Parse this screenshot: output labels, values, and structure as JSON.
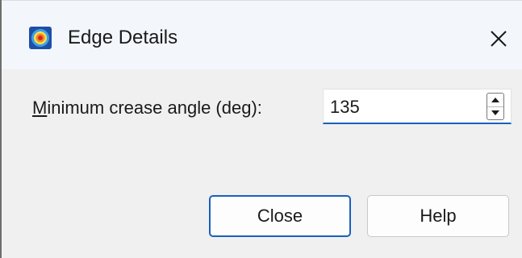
{
  "window": {
    "title": "Edge Details",
    "app_icon": "app-logo-icon",
    "close_icon": "close-icon"
  },
  "form": {
    "label_mnemonic": "M",
    "label_rest": "inimum crease angle (deg):",
    "value": "135",
    "spin_up_icon": "arrow-up-icon",
    "spin_down_icon": "arrow-down-icon"
  },
  "buttons": {
    "close_label": "Close",
    "help_label": "Help"
  },
  "colors": {
    "accent": "#1b5fbf",
    "dialog_bg": "#f0f0f0",
    "titlebar_bg": "#f3f7fb"
  }
}
